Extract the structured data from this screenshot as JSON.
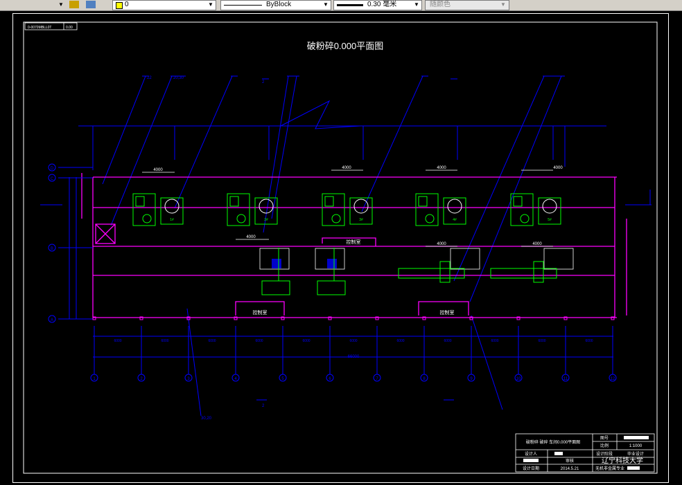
{
  "toolbar": {
    "layer_value": "0",
    "linetype_value": "ByBlock",
    "lineweight_value": "0.30 毫米",
    "plotstyle_value": "随颜色"
  },
  "drawing": {
    "title": "破粉碎0.000平面图",
    "tag_left": "0-0070MBLL0T",
    "tag_right": "0.00",
    "control_room_1": "控制室",
    "control_room_2": "控制室",
    "dim_4000": "4000",
    "row_axes": [
      "D",
      "C",
      "B",
      "A"
    ],
    "col_axes": [
      "1",
      "2",
      "3",
      "4",
      "5",
      "6",
      "7",
      "8",
      "9",
      "10",
      "11",
      "12"
    ],
    "bay_dims": [
      "6000",
      "6000",
      "6000",
      "6000",
      "6000",
      "6000",
      "6000",
      "6000",
      "6000",
      "6000",
      "6000"
    ],
    "total_dim": "66000",
    "crusher_labels": [
      "1#",
      "2#",
      "3#",
      "4#",
      "5#"
    ],
    "section_top": "2",
    "section_bottom": "2"
  },
  "title_block": {
    "drawing_name": "破粉碎 破碎 车间0.000平面图",
    "drawing_no_label": "图号",
    "scale_label": "比例",
    "scale_value": "1:1000",
    "designer_label": "设计人",
    "stage_label": "设计阶段",
    "stage_value": "毕业设计",
    "reviewer_label": "审核",
    "school": "辽宁科技大学",
    "date_label": "设计日期",
    "date_value": "2014.5.21",
    "major": "无机非金属专业"
  },
  "colors": {
    "blue": "#0000ff",
    "magenta": "#ff00ff",
    "green": "#00ff00",
    "white": "#ffffff"
  }
}
